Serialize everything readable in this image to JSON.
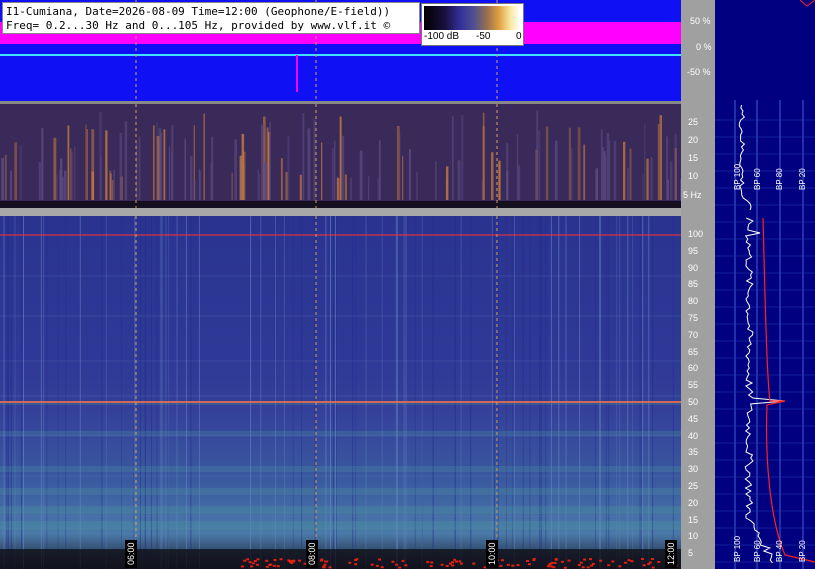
{
  "header": {
    "line1": "I1-Cumiana, Date=2026-08-09 Time=12:00 (Geophone/E-field))",
    "line2": "Freq= 0.2...30 Hz and 0...105 Hz, provided by www.vlf.it ©"
  },
  "legend": {
    "min_label": "-100 dB",
    "mid_label": "-50",
    "max_label": "0"
  },
  "amplitude_scale": [
    "50 %",
    "0 %",
    "-50 %"
  ],
  "low_freq_scale": [
    "25",
    "20",
    "15",
    "10",
    "5 Hz"
  ],
  "high_freq_scale": [
    "100",
    "95",
    "90",
    "85",
    "80",
    "75",
    "70",
    "65",
    "60",
    "55",
    "50",
    "45",
    "40",
    "35",
    "30",
    "25",
    "20",
    "15",
    "10",
    "5"
  ],
  "time_labels": [
    "06:00",
    "08:00",
    "10:00",
    "12:00"
  ],
  "band_labels_top": [
    "BP 100",
    "BP 60",
    "BP 80",
    "BP 20"
  ],
  "band_labels_bottom": [
    "BP 100",
    "BP 60",
    "BP 40",
    "BP 20"
  ],
  "colors": {
    "waveform_bg": "#1010f4",
    "waveform_envelope": "#ff00ff",
    "waveform_trace": "#40e0ff",
    "spectrogram_bg": "#2e3896",
    "profile_line": "#ff2020",
    "right_panel_bg": "#000080"
  }
}
